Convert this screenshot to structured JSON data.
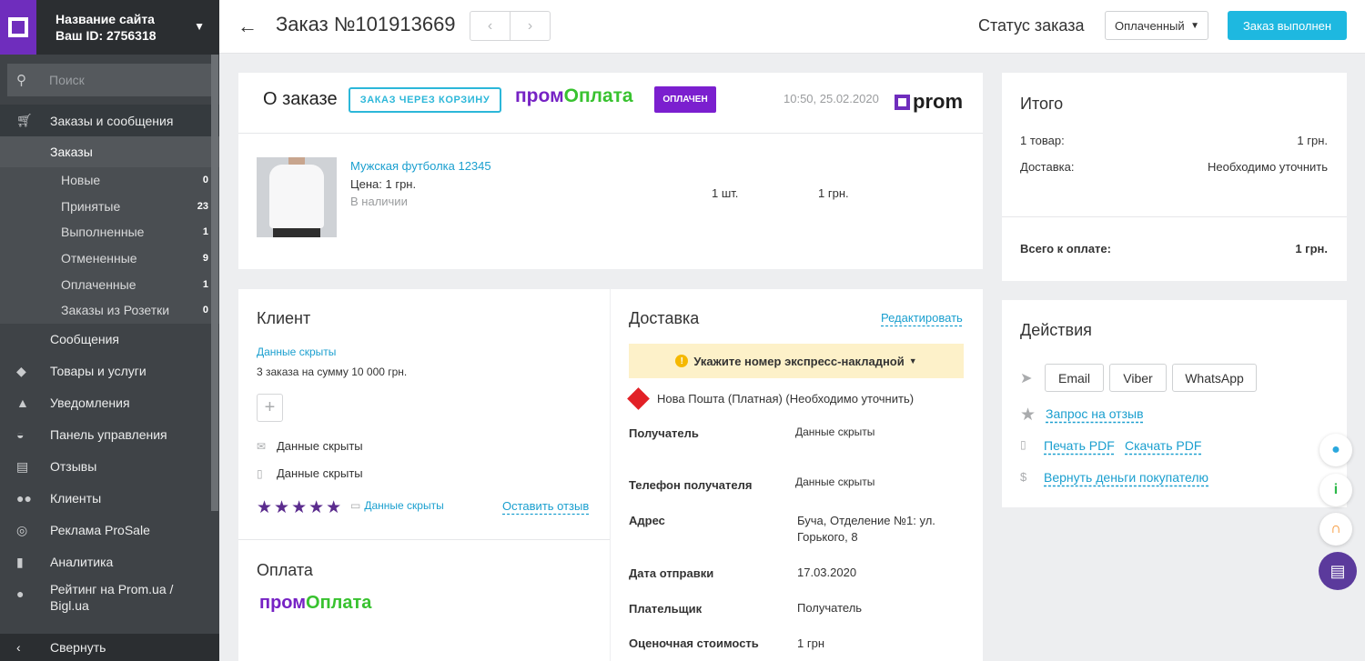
{
  "sidebar": {
    "site_name": "Название сайта",
    "site_id": "Ваш ID: 2756318",
    "search_placeholder": "Поиск",
    "orders_section": "Заказы и сообщения",
    "orders_title": "Заказы",
    "order_items": [
      {
        "label": "Новые",
        "count": "0"
      },
      {
        "label": "Принятые",
        "count": "23"
      },
      {
        "label": "Выполненные",
        "count": "1"
      },
      {
        "label": "Отмененные",
        "count": "9"
      },
      {
        "label": "Оплаченные",
        "count": "1"
      },
      {
        "label": "Заказы из Розетки",
        "count": "0"
      }
    ],
    "messages": "Сообщения",
    "nav": [
      {
        "label": "Товары и услуги",
        "icon": "tag-icon"
      },
      {
        "label": "Уведомления",
        "icon": "bell-icon"
      },
      {
        "label": "Панель управления",
        "icon": "dashboard-icon"
      },
      {
        "label": "Отзывы",
        "icon": "chat-icon"
      },
      {
        "label": "Клиенты",
        "icon": "people-icon"
      },
      {
        "label": "Реклама ProSale",
        "icon": "target-icon"
      },
      {
        "label": "Аналитика",
        "icon": "bar-chart-icon"
      },
      {
        "label": "Рейтинг на Prom.ua /",
        "label2": "Bigl.ua",
        "icon": "medal-icon"
      }
    ],
    "collapse": "Свернуть"
  },
  "topbar": {
    "title": "Заказ №101913669",
    "status_label": "Статус заказа",
    "status_value": "Оплаченный",
    "done_button": "Заказ выполнен"
  },
  "about": {
    "title": "О заказе",
    "cart_tag": "ЗАКАЗ ЧЕРЕЗ КОРЗИНУ",
    "prom_oplata_a": "пром",
    "prom_oplata_b": "Оплата",
    "paid_tag": "ОПЛАЧЕН",
    "datetime": "10:50, 25.02.2020",
    "prom_logo": "prom",
    "product_name": "Мужская футболка 12345",
    "product_price": "Цена: 1 грн.",
    "product_stock": "В наличии",
    "product_qty": "1 шт.",
    "product_sum": "1 грн."
  },
  "total": {
    "title": "Итого",
    "items_label": "1 товар:",
    "items_value": "1 грн.",
    "delivery_label": "Доставка:",
    "delivery_value": "Необходимо уточнить",
    "grand_label": "Всего к оплате:",
    "grand_value": "1 грн."
  },
  "actions": {
    "title": "Действия",
    "email": "Email",
    "viber": "Viber",
    "whatsapp": "WhatsApp",
    "review_request": "Запрос на отзыв",
    "print_pdf": "Печать PDF",
    "download_pdf": "Скачать PDF",
    "refund": "Вернуть деньги покупателю"
  },
  "client": {
    "title": "Клиент",
    "name_hidden": "Данные скрыты",
    "orders_summary": "3 заказа на сумму 10 000 грн.",
    "email": "Данные скрыты",
    "phone": "Данные скрыты",
    "stars": "★★★★★",
    "comment": "Данные скрыты",
    "leave_review": "Оставить отзыв",
    "payment_title": "Оплата",
    "payment_a": "пром",
    "payment_b": "Оплата"
  },
  "delivery": {
    "title": "Доставка",
    "edit": "Редактировать",
    "alert": "Укажите номер экспресс-накладной",
    "carrier": "Нова Пошта (Платная) (Необходимо уточнить)",
    "recipient_label": "Получатель",
    "recipient_value": "Данные скрыты",
    "phone_label": "Телефон получателя",
    "phone_value": "Данные скрыты",
    "address_label": "Адрес",
    "address_value_1": "Буча, Отделение №1: ул.",
    "address_value_2": "Горького, 8",
    "ship_date_label": "Дата отправки",
    "ship_date_value": "17.03.2020",
    "payer_label": "Плательщик",
    "payer_value": "Получатель",
    "est_cost_label": "Оценочная стоимость",
    "est_cost_value": "1 грн"
  }
}
